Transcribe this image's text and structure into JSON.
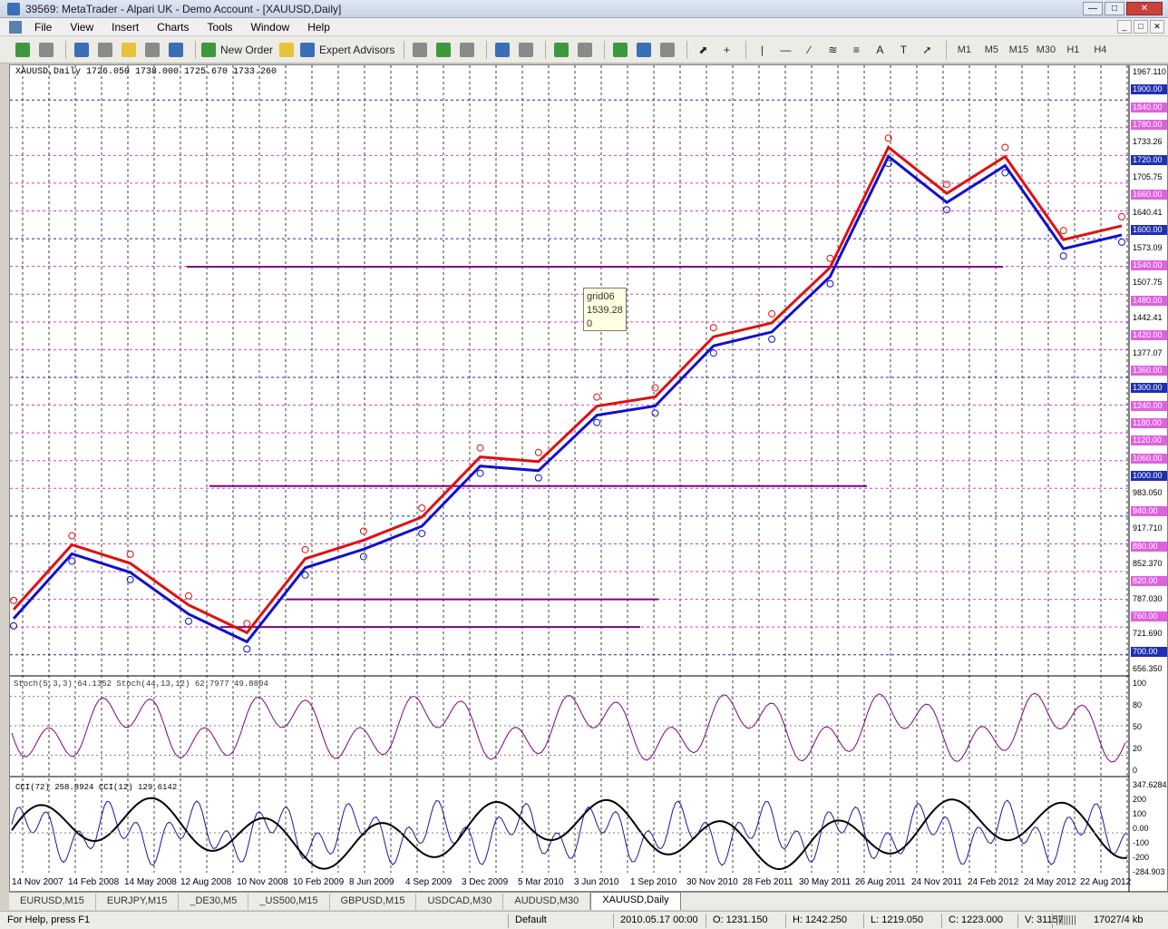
{
  "window": {
    "title": "39569: MetaTrader - Alpari UK - Demo Account - [XAUUSD,Daily]"
  },
  "menu": [
    "File",
    "View",
    "Insert",
    "Charts",
    "Tools",
    "Window",
    "Help"
  ],
  "toolbar": {
    "new_order": "New Order",
    "expert_advisors": "Expert Advisors",
    "timeframes": [
      "M1",
      "M5",
      "M15",
      "M30",
      "H1",
      "H4"
    ]
  },
  "chart": {
    "symbol_header": "XAUUSD,Daily  1726.050 1738.000 1725.670 1733.260",
    "stoch_header": "Stoch(5,3,3) 64.1352  Stoch(44,13,12) 62.7977 49.8804",
    "cci_header": "CCI(72) 258.8924  CCI(12) 129.6142",
    "tooltip": {
      "name": "grid06",
      "price": "1539.28",
      "value": "0"
    },
    "price_labels": [
      {
        "text": "1967.110",
        "style": "plain"
      },
      {
        "text": "1900.00",
        "style": "blue"
      },
      {
        "text": "1840.00",
        "style": "magenta"
      },
      {
        "text": "1780.00",
        "style": "magenta"
      },
      {
        "text": "1733.26",
        "style": "plain"
      },
      {
        "text": "1720.00",
        "style": "blue"
      },
      {
        "text": "1705.75",
        "style": "plain"
      },
      {
        "text": "1660.00",
        "style": "magenta"
      },
      {
        "text": "1640.41",
        "style": "plain"
      },
      {
        "text": "1600.00",
        "style": "blue"
      },
      {
        "text": "1573.09",
        "style": "plain"
      },
      {
        "text": "1540.00",
        "style": "magenta"
      },
      {
        "text": "1507.75",
        "style": "plain"
      },
      {
        "text": "1480.00",
        "style": "magenta"
      },
      {
        "text": "1442.41",
        "style": "plain"
      },
      {
        "text": "1420.00",
        "style": "magenta"
      },
      {
        "text": "1377.07",
        "style": "plain"
      },
      {
        "text": "1360.00",
        "style": "magenta"
      },
      {
        "text": "1300.00",
        "style": "blue"
      },
      {
        "text": "1240.00",
        "style": "magenta"
      },
      {
        "text": "1180.00",
        "style": "magenta"
      },
      {
        "text": "1120.00",
        "style": "magenta"
      },
      {
        "text": "1060.00",
        "style": "magenta"
      },
      {
        "text": "1000.00",
        "style": "blue"
      },
      {
        "text": "983.050",
        "style": "plain"
      },
      {
        "text": "940.00",
        "style": "magenta"
      },
      {
        "text": "917.710",
        "style": "plain"
      },
      {
        "text": "880.00",
        "style": "magenta"
      },
      {
        "text": "852.370",
        "style": "plain"
      },
      {
        "text": "820.00",
        "style": "magenta"
      },
      {
        "text": "787.030",
        "style": "plain"
      },
      {
        "text": "760.00",
        "style": "magenta"
      },
      {
        "text": "721.690",
        "style": "plain"
      },
      {
        "text": "700.00",
        "style": "blue"
      },
      {
        "text": "656.350",
        "style": "plain"
      }
    ],
    "stoch_axis": [
      "100",
      "80",
      "50",
      "20",
      "0"
    ],
    "cci_axis": [
      "347.6284",
      "200",
      "100",
      "0.00",
      "-100",
      "-200",
      "-284.903"
    ],
    "date_labels": [
      "14 Nov 2007",
      "14 Feb 2008",
      "14 May 2008",
      "12 Aug 2008",
      "10 Nov 2008",
      "10 Feb 2009",
      "8 Jun 2009",
      "4 Sep 2009",
      "3 Dec 2009",
      "5 Mar 2010",
      "3 Jun 2010",
      "1 Sep 2010",
      "30 Nov 2010",
      "28 Feb 2011",
      "30 May 2011",
      "26 Aug 2011",
      "24 Nov 2011",
      "24 Feb 2012",
      "24 May 2012",
      "22 Aug 2012"
    ]
  },
  "chart_data": {
    "type": "line",
    "x": [
      "14 Nov 2007",
      "14 Feb 2008",
      "14 May 2008",
      "12 Aug 2008",
      "10 Nov 2008",
      "10 Feb 2009",
      "8 Jun 2009",
      "4 Sep 2009",
      "3 Dec 2009",
      "5 Mar 2010",
      "3 Jun 2010",
      "1 Sep 2010",
      "30 Nov 2010",
      "28 Feb 2011",
      "30 May 2011",
      "26 Aug 2011",
      "24 Nov 2011",
      "24 Feb 2012",
      "24 May 2012",
      "22 Aug 2012"
    ],
    "series": [
      {
        "name": "XAUUSD,Daily",
        "values": [
          790,
          930,
          890,
          800,
          740,
          900,
          940,
          990,
          1120,
          1110,
          1230,
          1250,
          1380,
          1410,
          1530,
          1790,
          1690,
          1770,
          1590,
          1620
        ]
      }
    ],
    "ylim": [
      656.35,
      1967.11
    ],
    "horizontal_levels": [
      1539.28,
      1065,
      820,
      760
    ],
    "colors": {
      "bull": "#e01010",
      "bear": "#1010d0",
      "grid": "#000000",
      "level": "#800080"
    }
  },
  "tabs": [
    "EURUSD,M15",
    "EURJPY,M15",
    "_DE30,M5",
    "_US500,M15",
    "GBPUSD,M15",
    "USDCAD,M30",
    "AUDUSD,M30",
    "XAUUSD,Daily"
  ],
  "status": {
    "help": "For Help, press F1",
    "profile": "Default",
    "datetime": "2010.05.17 00:00",
    "open": "O: 1231.150",
    "high": "H: 1242.250",
    "low": "L: 1219.050",
    "close": "C: 1223.000",
    "volume": "V: 31157",
    "traffic": "17027/4 kb"
  }
}
